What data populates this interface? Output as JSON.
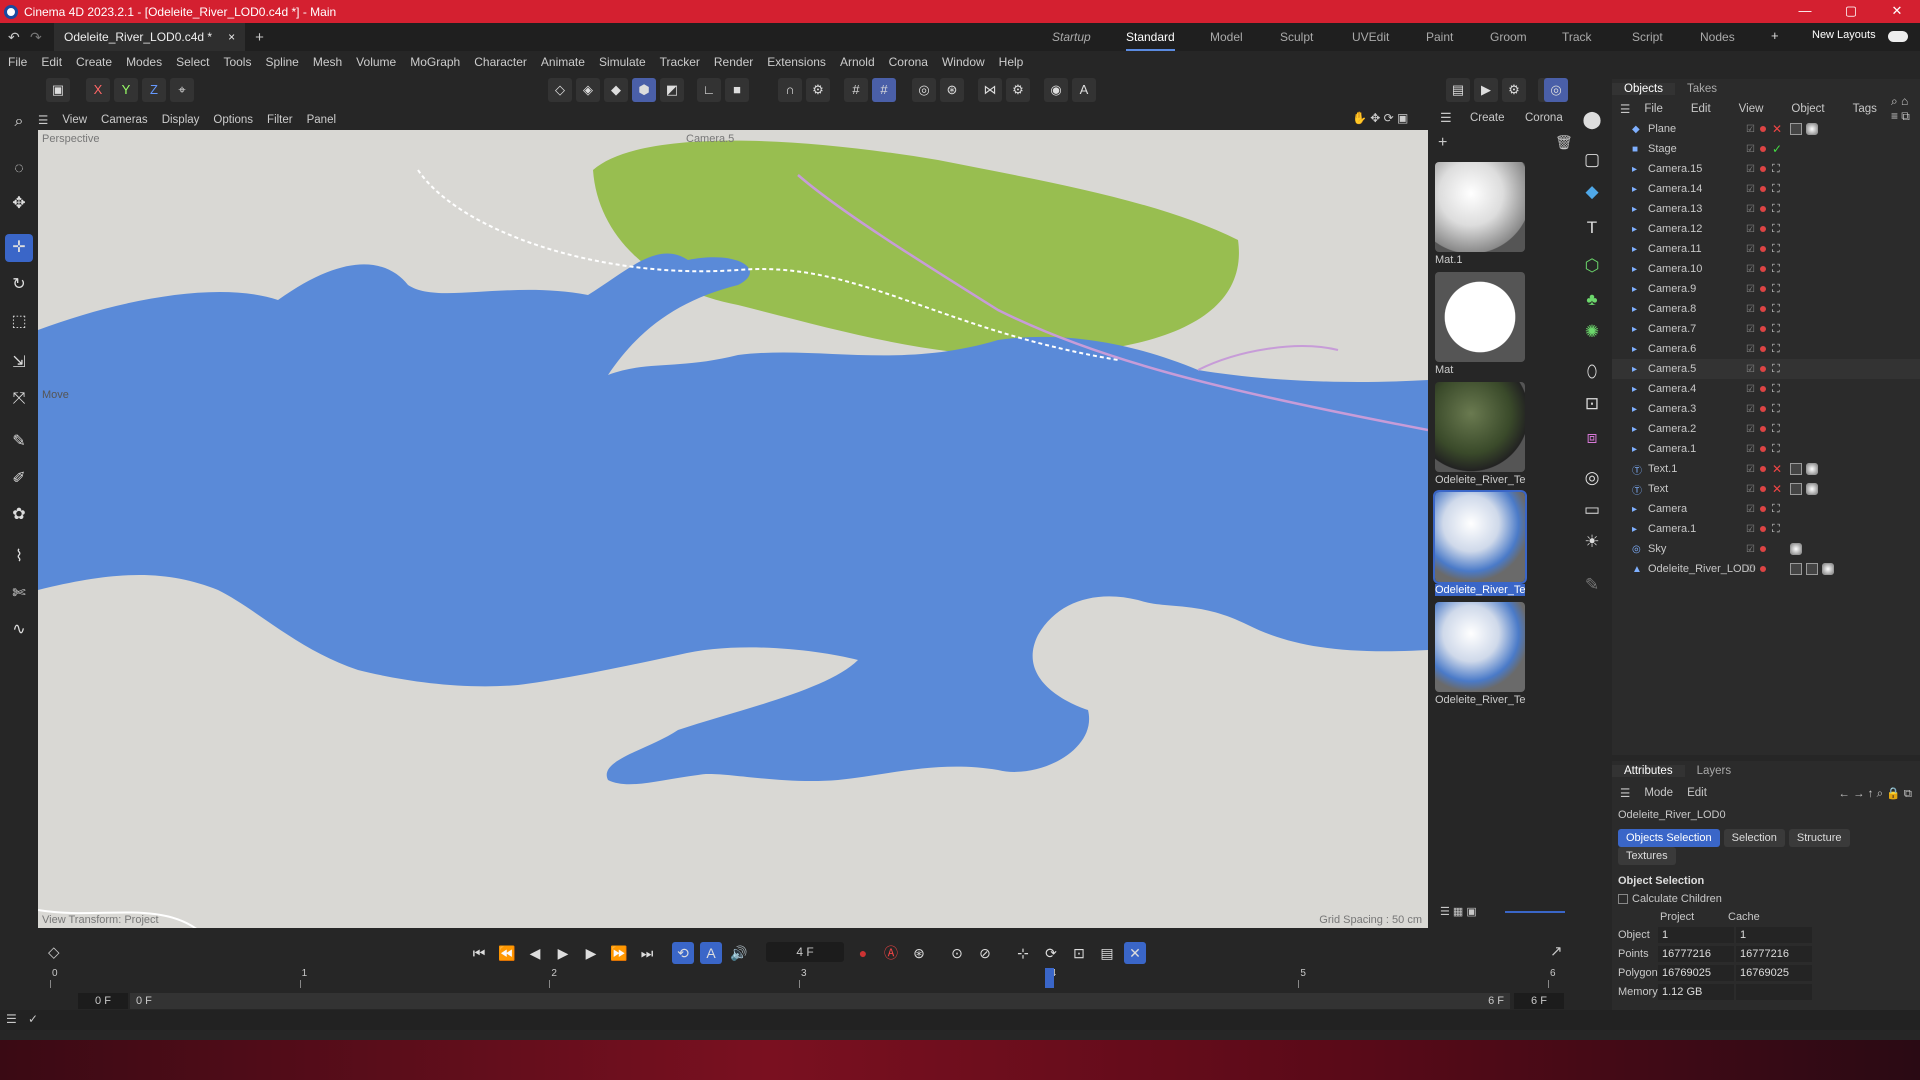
{
  "window": {
    "title": "Cinema 4D 2023.2.1 - [Odeleite_River_LOD0.c4d *] - Main",
    "controls": [
      "—",
      "▢",
      "✕"
    ]
  },
  "doc_tab": {
    "label": "Odeleite_River_LOD0.c4d *",
    "close": "×",
    "add": "+"
  },
  "layouts": [
    {
      "label": "Startup",
      "italic": true
    },
    {
      "label": "Standard",
      "active": true
    },
    {
      "label": "Model"
    },
    {
      "label": "Sculpt"
    },
    {
      "label": "UVEdit"
    },
    {
      "label": "Paint"
    },
    {
      "label": "Groom"
    },
    {
      "label": "Track"
    },
    {
      "label": "Script"
    },
    {
      "label": "Nodes"
    }
  ],
  "new_layouts": "New Layouts",
  "menu": [
    "File",
    "Edit",
    "Create",
    "Modes",
    "Select",
    "Tools",
    "Spline",
    "Mesh",
    "Volume",
    "MoGraph",
    "Character",
    "Animate",
    "Simulate",
    "Tracker",
    "Render",
    "Extensions",
    "Arnold",
    "Corona",
    "Window",
    "Help"
  ],
  "axis_buttons": [
    "X",
    "Y",
    "Z"
  ],
  "viewport": {
    "menu": [
      "View",
      "Cameras",
      "Display",
      "Options",
      "Filter",
      "Panel"
    ],
    "label": "Perspective",
    "camera": "Camera.5",
    "tool_label": "Move",
    "bottom_left": "View Transform: Project",
    "bottom_right": "Grid Spacing : 50 cm"
  },
  "material_panel": {
    "menu": [
      "Create",
      "Corona"
    ],
    "materials": [
      {
        "name": "Mat.1",
        "kind": "white-sphere"
      },
      {
        "name": "Mat",
        "kind": "white-flat"
      },
      {
        "name": "Odeleite_River_Te:",
        "kind": "terrain"
      },
      {
        "name": "Odeleite_River_Te:",
        "kind": "river-selected",
        "selected": true
      },
      {
        "name": "Odeleite_River_Te:",
        "kind": "river"
      }
    ]
  },
  "objects_panel": {
    "tabs": [
      "Objects",
      "Takes"
    ],
    "menu": [
      "File",
      "Edit",
      "View",
      "Object",
      "Tags"
    ],
    "rows": [
      {
        "name": "Plane",
        "icon": "plane",
        "status": "x",
        "tags": [
          "tex",
          "mat"
        ]
      },
      {
        "name": "Stage",
        "icon": "stage",
        "status": "check"
      },
      {
        "name": "Camera.15",
        "icon": "cam"
      },
      {
        "name": "Camera.14",
        "icon": "cam"
      },
      {
        "name": "Camera.13",
        "icon": "cam"
      },
      {
        "name": "Camera.12",
        "icon": "cam"
      },
      {
        "name": "Camera.11",
        "icon": "cam"
      },
      {
        "name": "Camera.10",
        "icon": "cam"
      },
      {
        "name": "Camera.9",
        "icon": "cam"
      },
      {
        "name": "Camera.8",
        "icon": "cam"
      },
      {
        "name": "Camera.7",
        "icon": "cam"
      },
      {
        "name": "Camera.6",
        "icon": "cam"
      },
      {
        "name": "Camera.5",
        "icon": "cam",
        "active": true
      },
      {
        "name": "Camera.4",
        "icon": "cam"
      },
      {
        "name": "Camera.3",
        "icon": "cam"
      },
      {
        "name": "Camera.2",
        "icon": "cam"
      },
      {
        "name": "Camera.1",
        "icon": "cam"
      },
      {
        "name": "Text.1",
        "icon": "text",
        "status": "x",
        "tags": [
          "tex",
          "mat"
        ]
      },
      {
        "name": "Text",
        "icon": "text",
        "status": "x",
        "tags": [
          "tex",
          "mat"
        ]
      },
      {
        "name": "Camera",
        "icon": "cam"
      },
      {
        "name": "Camera.1",
        "icon": "cam"
      },
      {
        "name": "Sky",
        "icon": "sky",
        "tags": [
          "sky"
        ]
      },
      {
        "name": "Odeleite_River_LOD0",
        "icon": "mesh",
        "tags": [
          "uv",
          "tex",
          "mat"
        ]
      }
    ]
  },
  "attributes": {
    "tabs": [
      "Attributes",
      "Layers"
    ],
    "menu": [
      "Mode",
      "Edit"
    ],
    "object_name": "Odeleite_River_LOD0",
    "sub_tabs": [
      "Objects Selection",
      "Selection",
      "Structure",
      "Textures"
    ],
    "section": "Object Selection",
    "checkbox": "Calculate Children",
    "table": {
      "headers": [
        "Project",
        "Cache"
      ],
      "rows": [
        {
          "label": "Object",
          "project": "1",
          "cache": "1"
        },
        {
          "label": "Points",
          "project": "16777216",
          "cache": "16777216"
        },
        {
          "label": "Polygons",
          "project": "16769025",
          "cache": "16769025"
        },
        {
          "label": "Memory",
          "project": "1.12 GB",
          "cache": ""
        }
      ]
    }
  },
  "timeline": {
    "current_frame": "4 F",
    "ticks": [
      "0",
      "1",
      "2",
      "3",
      "4",
      "5",
      "6"
    ],
    "start": "0 F",
    "range_start": "0 F",
    "range_end": "6 F",
    "end": "6 F",
    "playhead": 4,
    "max": 6
  },
  "colors": {
    "accent": "#3a66c8",
    "water": "#5a8ad8",
    "vegetation": "#98be50",
    "terrain": "#d9d8d4",
    "titlebar": "#d42030"
  }
}
